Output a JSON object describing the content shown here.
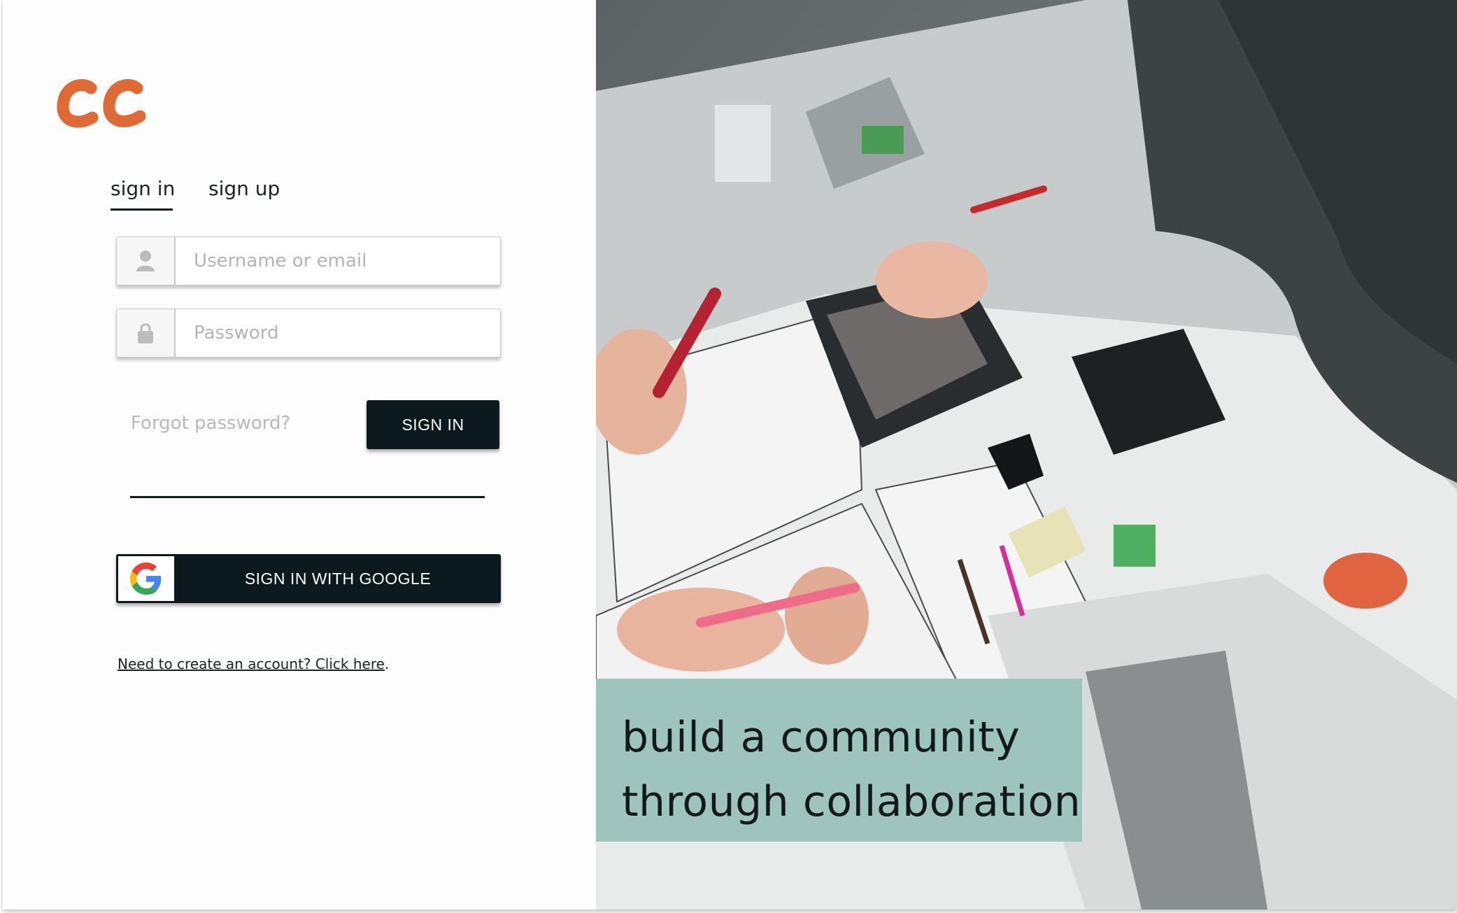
{
  "brand": {
    "logo_text": "cc",
    "logo_color": "#e06a35"
  },
  "tabs": {
    "signin": "sign in",
    "signup": "sign up",
    "active": "signin"
  },
  "form": {
    "username_placeholder": "Username or email",
    "password_placeholder": "Password",
    "forgot_label": "Forgot password?",
    "signin_label": "SIGN IN",
    "google_label": "SIGN IN WITH GOOGLE"
  },
  "create": {
    "link_text": "Need to create an account? Click here",
    "suffix": "."
  },
  "hero": {
    "line1": "build a community",
    "line2": "through collaboration",
    "banner_color": "#9ec5bd"
  },
  "colors": {
    "primary_button": "#0d1a1d"
  },
  "icons": [
    "user-icon",
    "lock-icon",
    "google-icon"
  ]
}
